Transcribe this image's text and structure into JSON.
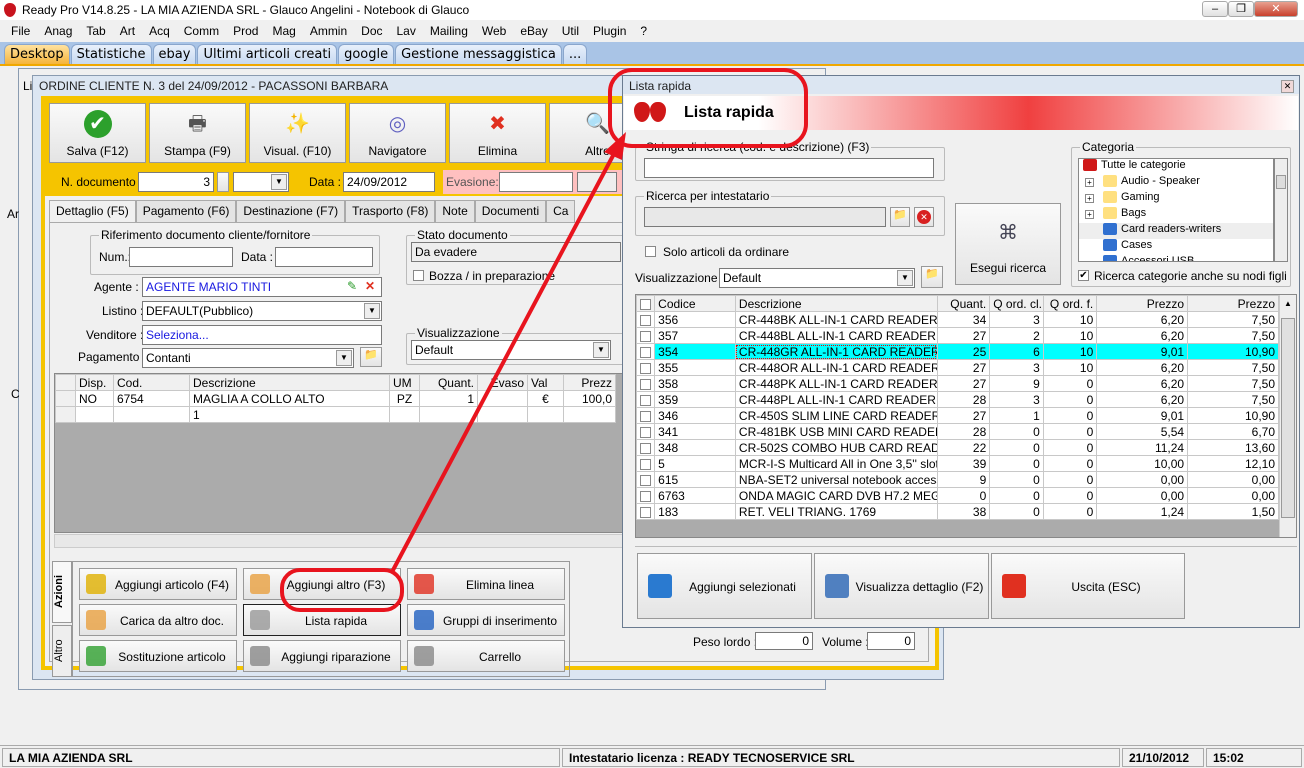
{
  "app": {
    "title": "Ready Pro V14.8.25 - LA MIA AZIENDA SRL - Glauco Angelini - Notebook di Glauco"
  },
  "menu": [
    "File",
    "Anag",
    "Tab",
    "Art",
    "Acq",
    "Comm",
    "Prod",
    "Mag",
    "Ammin",
    "Doc",
    "Lav",
    "Mailing",
    "Web",
    "eBay",
    "Util",
    "Plugin",
    "?"
  ],
  "tabs": [
    "Desktop",
    "Statistiche",
    "ebay",
    "Ultimi articoli creati",
    "google",
    "Gestione messaggistica",
    "..."
  ],
  "bgwin": {
    "l1": "Li",
    "l2": "Ar",
    "l3": "C"
  },
  "order": {
    "title": "ORDINE CLIENTE N. 3  del 24/09/2012 - PACASSONI BARBARA",
    "toolbar": [
      "Salva (F12)",
      "Stampa (F9)",
      "Visual. (F10)",
      "Navigatore",
      "Elimina",
      "Altro"
    ],
    "ndoc_label": "N. documento :",
    "ndoc_value": "3",
    "data_label": "Data :",
    "data_value": "24/09/2012",
    "evasione_label": "Evasione:",
    "subtabs": [
      "Dettaglio (F5)",
      "Pagamento (F6)",
      "Destinazione (F7)",
      "Trasporto (F8)",
      "Note",
      "Documenti",
      "Ca"
    ],
    "rif_group": "Riferimento documento cliente/fornitore",
    "num_label": "Num.:",
    "data2_label": "Data :",
    "agente_label": "Agente :",
    "agente_value": "AGENTE MARIO TINTI",
    "listino_label": "Listino :",
    "listino_value": "DEFAULT(Pubblico)",
    "venditore_label": "Venditore :",
    "venditore_value": "Seleziona...",
    "pagamento_label": "Pagamento :",
    "pagamento_value": "Contanti",
    "stato_group": "Stato documento",
    "stato_value": "Da evadere",
    "bozza_label": "Bozza / in preparazione",
    "vis_group": "Visualizzazione",
    "vis_value": "Default",
    "grid_headers": [
      "Disp.",
      "Cod.",
      "Descrizione",
      "UM",
      "Quant.",
      "Evaso",
      "Val",
      "Prezz"
    ],
    "grid_rows": [
      [
        "NO",
        "6754",
        "MAGLIA A COLLO ALTO",
        "PZ",
        "1",
        "",
        "€",
        "100,0"
      ],
      [
        "",
        "",
        "1",
        "",
        "",
        "",
        "",
        ""
      ]
    ],
    "side_tabs": [
      "Azioni",
      "Altro"
    ],
    "actions": [
      "Aggiungi articolo (F4)",
      "Aggiungi altro (F3)",
      "Elimina linea",
      "Carica da altro doc.",
      "Lista rapida",
      "Gruppi di inserimento",
      "Sostituzione articolo",
      "Aggiungi riparazione",
      "Carrello"
    ],
    "peso_label": "Peso lordo :",
    "peso_value": "0",
    "volume_label": "Volume :",
    "volume_value": "0"
  },
  "lista": {
    "title": "Lista rapida",
    "header": "Lista rapida",
    "search_group": "Stringa di ricerca (cod. e descrizione) (F3)",
    "intestatario_group": "Ricerca per intestatario",
    "solo_label": "Solo articoli da ordinare",
    "vis_label": "Visualizzazione :",
    "vis_value": "Default",
    "search_button": "Esegui ricerca",
    "cat_group": "Categoria",
    "categories": [
      "Tutte le categorie",
      "Audio - Speaker",
      "Gaming",
      "Bags",
      "Card readers-writers",
      "Cases",
      "Accessori USB"
    ],
    "cat_children_label": "Ricerca categorie anche su nodi figli",
    "headers": [
      "Codice",
      "Descrizione",
      "Quant.",
      "Q ord. cl.",
      "Q ord. f.",
      "Prezzo",
      "Prezzo"
    ],
    "rows": [
      [
        "356",
        "CR-448BK ALL-IN-1 CARD READER ...",
        "34",
        "3",
        "10",
        "6,20",
        "7,50"
      ],
      [
        "357",
        "CR-448BL ALL-IN-1 CARD READER B...",
        "27",
        "2",
        "10",
        "6,20",
        "7,50"
      ],
      [
        "354",
        "CR-448GR ALL-IN-1 CARD READER ...",
        "25",
        "6",
        "10",
        "9,01",
        "10,90"
      ],
      [
        "355",
        "CR-448OR ALL-IN-1 CARD READER ...",
        "27",
        "3",
        "10",
        "6,20",
        "7,50"
      ],
      [
        "358",
        "CR-448PK ALL-IN-1 CARD READER ...",
        "27",
        "9",
        "0",
        "6,20",
        "7,50"
      ],
      [
        "359",
        "CR-448PL ALL-IN-1 CARD READER P...",
        "28",
        "3",
        "0",
        "6,20",
        "7,50"
      ],
      [
        "346",
        "CR-450S SLIM LINE CARD READER ...",
        "27",
        "1",
        "0",
        "9,01",
        "10,90"
      ],
      [
        "341",
        "CR-481BK USB MINI CARD READER ...",
        "28",
        "0",
        "0",
        "5,54",
        "6,70"
      ],
      [
        "348",
        "CR-502S COMBO HUB CARD READE...",
        "22",
        "0",
        "0",
        "11,24",
        "13,60"
      ],
      [
        "5",
        "MCR-I-S Multicard All in One 3,5'' slot ...",
        "39",
        "0",
        "0",
        "10,00",
        "12,10"
      ],
      [
        "615",
        "NBA-SET2 universal notebook access...",
        "9",
        "0",
        "0",
        "0,00",
        "0,00"
      ],
      [
        "6763",
        "ONDA MAGIC CARD DVB H7.2 MEG...",
        "0",
        "0",
        "0",
        "0,00",
        "0,00"
      ],
      [
        "183",
        "RET. VELI TRIANG. 1769",
        "38",
        "0",
        "0",
        "1,24",
        "1,50"
      ]
    ],
    "selected_row": 2,
    "bottom_buttons": [
      "Aggiungi selezionati",
      "Visualizza dettaglio (F2)",
      "Uscita (ESC)"
    ]
  },
  "status": {
    "company": "LA MIA AZIENDA SRL",
    "license": "Intestatario licenza : READY TECNOSERVICE SRL",
    "date": "21/10/2012",
    "time": "15:02"
  },
  "colors": {
    "accent_yellow": "#f5c400",
    "highlight": "#00ffff",
    "annotation_red": "#e8141e"
  }
}
